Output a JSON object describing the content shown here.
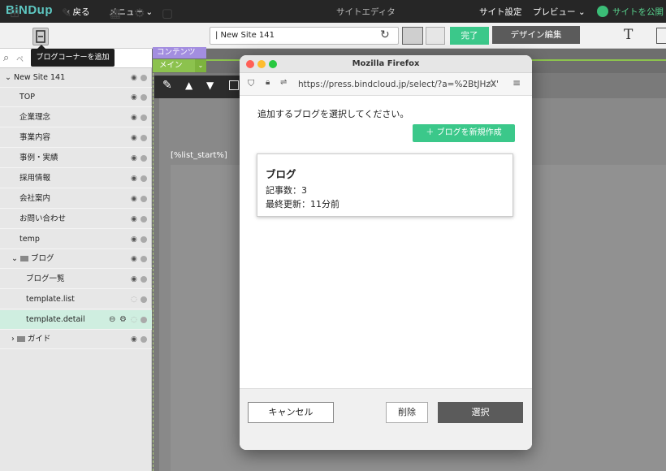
{
  "app": {
    "logo": "BiNDup",
    "back": "‹ 戻る",
    "menu": "メニュー ⌄",
    "title": "サイトエディタ",
    "settings": "サイト設定",
    "preview": "プレビュー ⌄",
    "publish": "サイトを公開"
  },
  "toolbar": {
    "url": "| New Site 141",
    "done": "完了",
    "design": "デザイン編集",
    "font_icon": "T",
    "tooltip": "ブログコーナーを追加"
  },
  "sidebar": {
    "search_placeholder": "ペ",
    "items": [
      {
        "label": "New Site 141",
        "indent": "root"
      },
      {
        "label": "TOP"
      },
      {
        "label": "企業理念"
      },
      {
        "label": "事業内容"
      },
      {
        "label": "事例・実績"
      },
      {
        "label": "採用情報"
      },
      {
        "label": "会社案内"
      },
      {
        "label": "お問い合わせ"
      },
      {
        "label": "temp"
      },
      {
        "label": "ブログ"
      },
      {
        "label": "ブログ一覧"
      },
      {
        "label": "template.list"
      },
      {
        "label": "template.detail"
      },
      {
        "label": "ガイド"
      }
    ]
  },
  "canvas": {
    "tab_content": "コンテンツ",
    "tab_main": "メイン",
    "list_start": "[%list_start%]"
  },
  "modal": {
    "window_title": "Mozilla Firefox",
    "url": "https://press.bindcloud.jp/select/?a=%2BtJHzX'",
    "prompt": "追加するブログを選択してください。",
    "new_blog": "＋ ブログを新規作成",
    "blog": {
      "title": "ブログ",
      "count": "記事数：3",
      "updated": "最終更新：11分前"
    },
    "cancel": "キャンセル",
    "delete": "削除",
    "select": "選択"
  },
  "colors": {
    "accent_green": "#3bc88a",
    "content_tab": "#a38ee0",
    "main_tab": "#8cc24e",
    "logo": "#5ec8c2"
  }
}
